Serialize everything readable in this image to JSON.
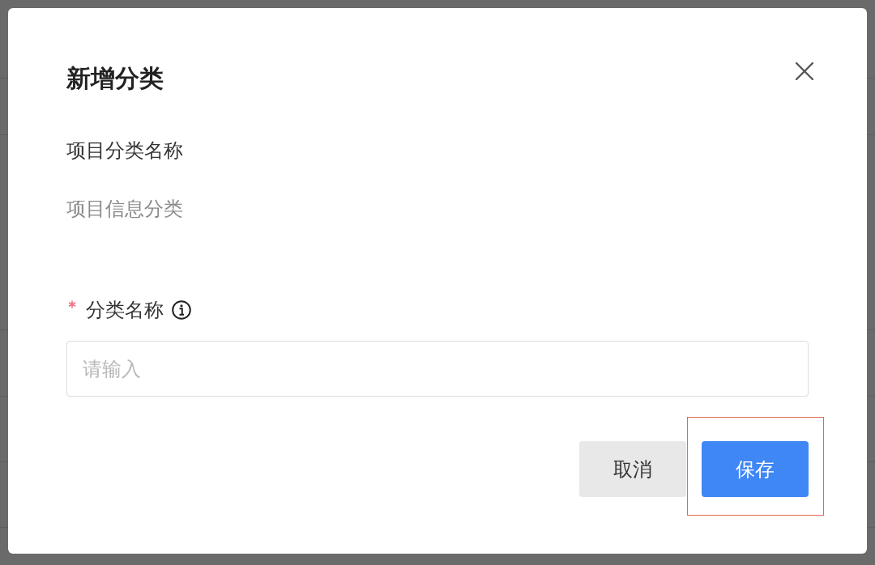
{
  "dialog": {
    "title": "新增分类",
    "info": {
      "label": "项目分类名称",
      "value": "项目信息分类"
    },
    "field": {
      "label": "分类名称",
      "required": true,
      "placeholder": "请输入"
    },
    "buttons": [
      {
        "label": "取消",
        "kind": "secondary",
        "highlighted": false
      },
      {
        "label": "保存",
        "kind": "primary",
        "highlighted": true
      }
    ]
  }
}
